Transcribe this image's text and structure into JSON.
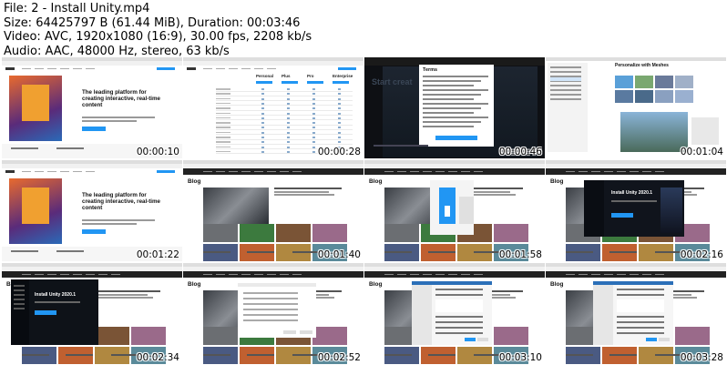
{
  "header": {
    "file": "File: 2 - Install Unity.mp4",
    "size": "Size: 64425797 B (61.44 MiB), Duration: 00:03:46",
    "video": "Video: AVC, 1920x1080 (16:9), 30.00 fps, 2208 kb/s",
    "audio": "Audio: AAC, 48000 Hz, stereo, 63 kb/s"
  },
  "thumbnails": [
    {
      "time": "00:00:10",
      "scene": "unity-home",
      "headline": "The leading platform for creating interactive, real-time content"
    },
    {
      "time": "00:00:28",
      "scene": "pricing",
      "plans": [
        "Personal",
        "Plus",
        "Pro",
        "Enterprise"
      ]
    },
    {
      "time": "00:00:46",
      "scene": "terms-dark",
      "dialog_title": "Terms",
      "bg_text": "Start creat"
    },
    {
      "time": "00:01:04",
      "scene": "personalize",
      "heading": "Personalize with Meshes"
    },
    {
      "time": "00:01:22",
      "scene": "unity-home",
      "headline": "The leading platform for creating interactive, real-time content"
    },
    {
      "time": "00:01:40",
      "scene": "blog",
      "brand": "Blog"
    },
    {
      "time": "00:01:58",
      "scene": "blog-download",
      "brand": "Blog"
    },
    {
      "time": "00:02:16",
      "scene": "blog-installer",
      "installer_title": "Install Unity 2020.1"
    },
    {
      "time": "00:02:34",
      "scene": "blog-installer-left",
      "installer_title": "Install Unity 2020.1",
      "brand": "Blog"
    },
    {
      "time": "00:02:52",
      "scene": "blog-dialog",
      "brand": "Blog"
    },
    {
      "time": "00:03:10",
      "scene": "blog-setup",
      "brand": "Blog"
    },
    {
      "time": "00:03:28",
      "scene": "blog-setup",
      "brand": "Blog"
    }
  ],
  "colors": {
    "unity_dark": "#1a1a1a",
    "accent_blue": "#2196f3",
    "page_bg": "#ffffff"
  }
}
